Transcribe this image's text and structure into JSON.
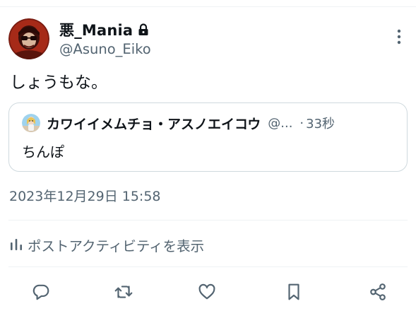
{
  "tweet": {
    "display_name": "悪_Mania",
    "handle": "@Asuno_Eiko",
    "text": "しょうもな。",
    "protected_icon": "lock-icon",
    "more_icon": "more-vertical-icon"
  },
  "quote": {
    "display_name": "カワイイメムチョ・アスノエイコウ",
    "handle": "@...",
    "separator": "·",
    "time": "33秒",
    "text": "ちんぽ"
  },
  "timestamp": "2023年12月29日 15:58",
  "activity": {
    "label": "ポストアクティビティを表示",
    "icon": "bar-chart-icon"
  },
  "actions": [
    {
      "name": "reply",
      "icon": "reply-icon"
    },
    {
      "name": "repost",
      "icon": "repost-icon"
    },
    {
      "name": "like",
      "icon": "heart-icon"
    },
    {
      "name": "bookmark",
      "icon": "bookmark-icon"
    },
    {
      "name": "share",
      "icon": "share-icon"
    }
  ],
  "colors": {
    "text": "#0f1419",
    "secondary": "#536471",
    "border": "#cfd9de",
    "divider": "#eff3f4"
  }
}
